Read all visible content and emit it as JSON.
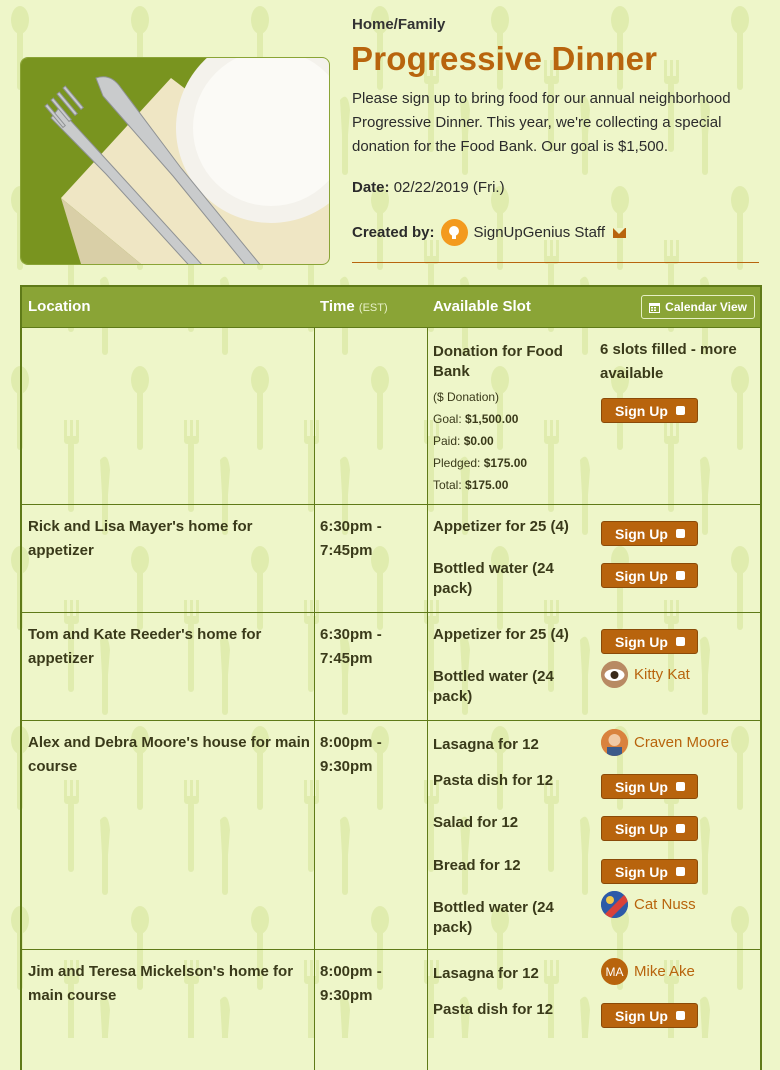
{
  "header": {
    "category": "Home/Family",
    "title": "Progressive Dinner",
    "description": "Please sign up to bring food for our annual neighborhood Progressive Dinner. This year, we're collecting a special donation for the Food Bank. Our goal is $1,500.",
    "date_label": "Date:",
    "date_value": "02/22/2019 (Fri.)",
    "created_by_label": "Created by:",
    "creator_name": "SignUpGenius Staff"
  },
  "table": {
    "col_location": "Location",
    "col_time": "Time",
    "col_time_tz": "(EST)",
    "col_slot": "Available Slot",
    "calendar_view": "Calendar View",
    "donation": {
      "title": "Donation for Food Bank",
      "type": "($ Donation)",
      "goal_label": "Goal:",
      "goal": "$1,500.00",
      "paid_label": "Paid:",
      "paid": "$0.00",
      "pledged_label": "Pledged:",
      "pledged": "$175.00",
      "total_label": "Total:",
      "total": "$175.00",
      "status": "6 slots filled - more available"
    },
    "rows": [
      {
        "location": "Rick and Lisa Mayer's home for appetizer",
        "time": "6:30pm - 7:45pm",
        "slots": [
          "Appetizer for 25 (4)",
          "Bottled water (24 pack)"
        ]
      },
      {
        "location": "Tom and Kate Reeder's home for appetizer",
        "time": "6:30pm - 7:45pm",
        "slots": [
          "Appetizer for 25 (4)",
          "Bottled water (24 pack)"
        ]
      },
      {
        "location": "Alex and Debra Moore's house for main course",
        "time": "8:00pm - 9:30pm",
        "slots": [
          "Lasagna for 12",
          "Pasta dish for 12",
          "Salad for 12",
          "Bread for 12",
          "Bottled water (24 pack)"
        ]
      },
      {
        "location": "Jim and Teresa Mickelson's home for main course",
        "time": "8:00pm - 9:30pm",
        "slots": [
          "Lasagna for 12",
          "Pasta dish for 12"
        ]
      }
    ],
    "signup_label": "Sign Up",
    "people": {
      "kitty": "Kitty Kat",
      "craven": "Craven Moore",
      "cat": "Cat Nuss",
      "mike": "Mike Ake",
      "mike_initials": "MA"
    }
  },
  "colors": {
    "accent": "#b8640d",
    "header_green": "#8aa436",
    "background": "#eef6c9"
  }
}
